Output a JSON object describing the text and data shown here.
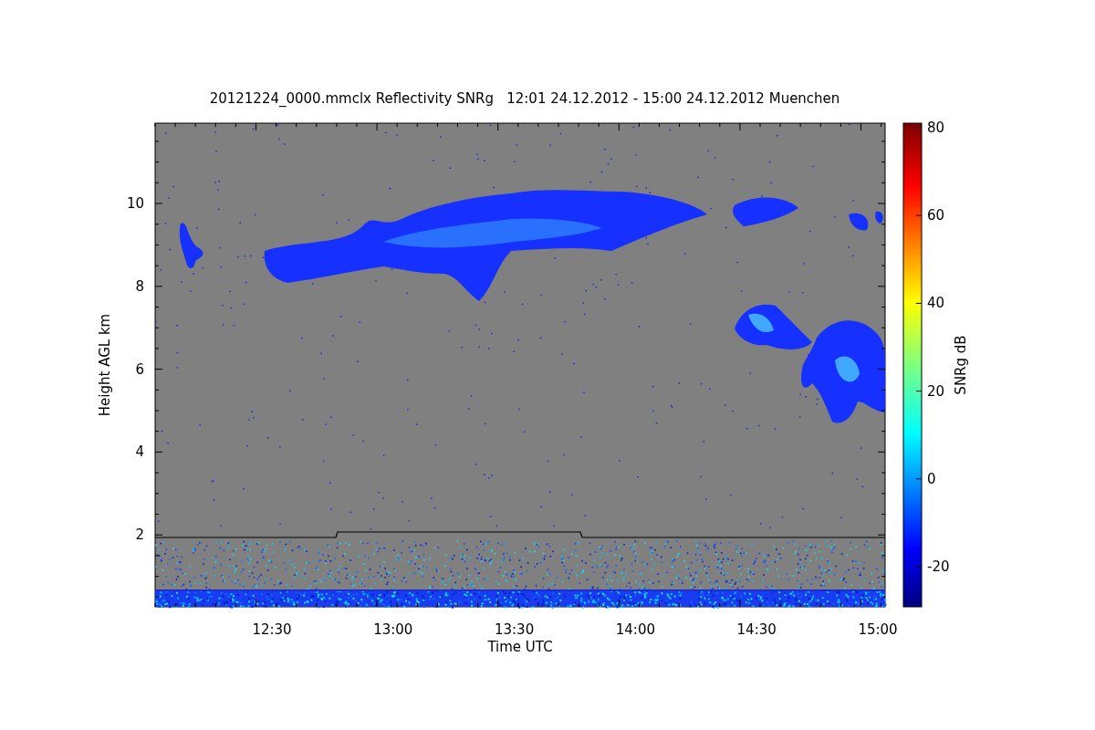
{
  "title": "20121224_0000.mmclx Reflectivity SNRg   12:01 24.12.2012 - 15:00 24.12.2012 Muenchen",
  "plot": {
    "xlabel": "Time UTC",
    "ylabel": "Height AGL km",
    "xticks": [
      "12:30",
      "13:00",
      "13:30",
      "14:00",
      "14:30",
      "15:00"
    ],
    "yticks": [
      "10",
      "8",
      "6",
      "4",
      "2"
    ]
  },
  "colorbar": {
    "label": "SNRg dB",
    "ticks": [
      "80",
      "60",
      "40",
      "20",
      "0",
      "-20"
    ]
  }
}
